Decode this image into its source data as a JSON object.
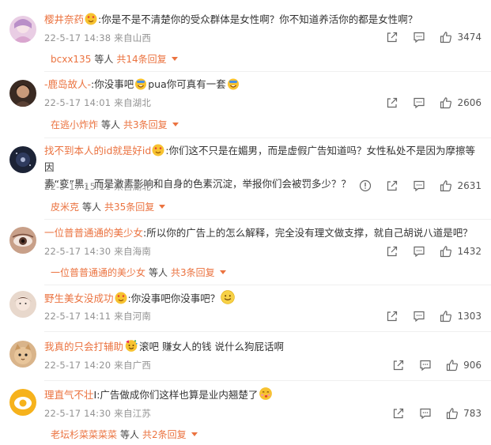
{
  "comments": [
    {
      "name": "樱井奈药",
      "text": ":你是不是不清楚你的受众群体是女性啊？你不知道养活你的都是女性啊？",
      "date": "22-5-17 14:38",
      "location": "来自山西",
      "likes": "3474",
      "reply_name": "bcxx135",
      "reply_mid": "等人",
      "reply_count": "共14条回复"
    },
    {
      "name": "-鹿岛故人-",
      "text_a": ":你没事吧",
      "text_b": "pua你可真有一套",
      "date": "22-5-17 14:01",
      "location": "来自湖北",
      "likes": "2606",
      "reply_name": "在逃小炸炸",
      "reply_mid": "等人",
      "reply_count": "共3条回复"
    },
    {
      "name": "找不到本人的id就是好id",
      "line1": ":你们这不只是在媚男，而是虚假广告知道吗？女性私处不是因为摩擦等因",
      "line2": "素“变”黑，而是激素影响和自身的色素沉淀，举报你们会被罚多少？？",
      "date": "22-5-17 15:11",
      "location": "来自湖北",
      "likes": "2631",
      "reply_name": "皮米克",
      "reply_mid": "等人",
      "reply_count": "共35条回复"
    },
    {
      "name": "一位普普通通的美少女",
      "text": ":所以你的广告上的怎么解释，完全没有理文做支撑，就自己胡说八道是吧？",
      "date": "22-5-17 14:30",
      "location": "来自海南",
      "likes": "1432",
      "reply_name": "一位普普通通的美少女",
      "reply_mid": "等人",
      "reply_count": "共3条回复"
    },
    {
      "name": "野生美女没成功",
      "text": ":你没事吧你没事吧？",
      "date": "22-5-17 14:11",
      "location": "来自河南",
      "likes": "1303"
    },
    {
      "name": "我真的只会打辅助",
      "text": "滚吧 赚女人的钱 说什么狗屁话啊",
      "date": "22-5-17 14:20",
      "location": "来自广西",
      "likes": "906"
    },
    {
      "name": "理直气不壮",
      "text": "I:广告做成你们这样也算是业内翘楚了",
      "date": "22-5-17 14:30",
      "location": "来自江苏",
      "likes": "783",
      "reply_name": "老坛杉菜菜菜菜",
      "reply_mid": "等人",
      "reply_count": "共2条回复"
    }
  ],
  "icons": {
    "share": "share-icon",
    "comment": "comment-icon",
    "like": "thumbs-up-icon",
    "report": "report-icon"
  },
  "colors": {
    "username": "#eb7340",
    "meta": "#939393"
  }
}
